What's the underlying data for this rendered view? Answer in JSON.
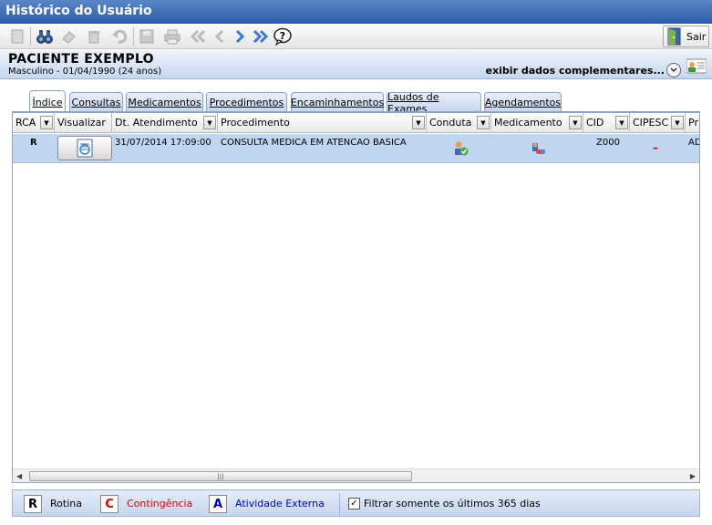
{
  "window": {
    "title": "Histórico do Usuário"
  },
  "toolbar": {
    "sair_label": "Sair"
  },
  "patient": {
    "name": "PACIENTE EXEMPLO",
    "info": "Masculino - 01/04/1990 (24 anos)",
    "extra_label": "exibir dados complementares..."
  },
  "tabs": [
    {
      "label": "Índice"
    },
    {
      "label": "Consultas"
    },
    {
      "label": "Medicamentos"
    },
    {
      "label": "Procedimentos"
    },
    {
      "label": "Encaminhamentos"
    },
    {
      "label": "Laudos de Exames"
    },
    {
      "label": "Agendamentos"
    }
  ],
  "grid": {
    "columns": [
      "RCA",
      "Visualizar",
      "Dt. Atendimento",
      "Procedimento",
      "Conduta",
      "Medicamento",
      "CID",
      "CIPESC",
      "Pr"
    ],
    "rows": [
      {
        "rca": "R",
        "dt": "31/07/2014 17:09:00",
        "procedimento": "CONSULTA MEDICA EM ATENCAO BASICA",
        "cid": "Z000",
        "cipesc": "–",
        "pr": "AD"
      }
    ]
  },
  "legend": {
    "rotina_letter": "R",
    "rotina": "Rotina",
    "contingencia_letter": "C",
    "contingencia": "Contingência",
    "externa_letter": "A",
    "externa": "Atividade Externa",
    "filter": "Filtrar somente os últimos 365 dias",
    "check": "✓",
    "colors": {
      "rotina": "#000000",
      "contingencia": "#e00000",
      "externa": "#0000cc"
    }
  }
}
